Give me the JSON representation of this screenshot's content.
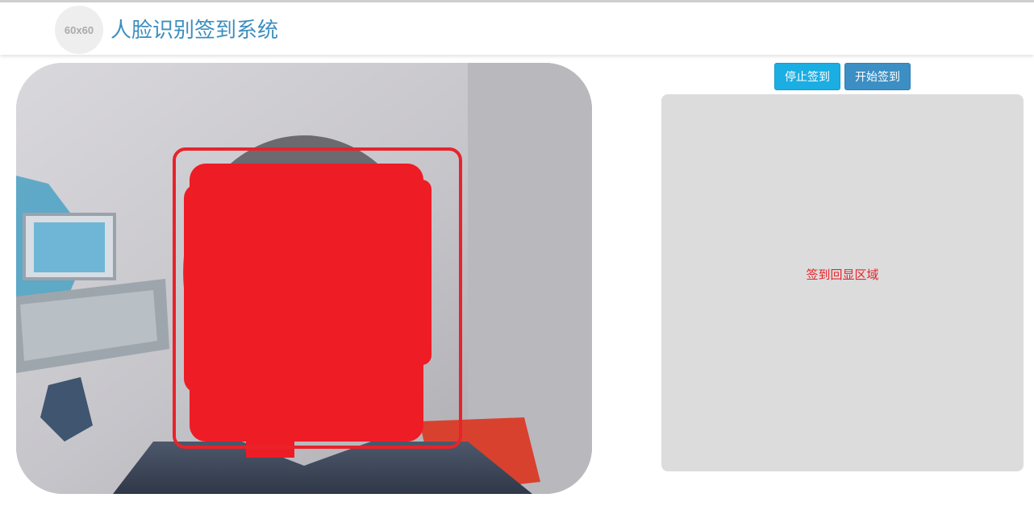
{
  "header": {
    "logo_text": "60x60",
    "title": "人脸识别签到系统"
  },
  "controls": {
    "stop_label": "停止签到",
    "start_label": "开始签到"
  },
  "result_panel": {
    "placeholder": "签到回显区域"
  },
  "colors": {
    "title": "#3d8ebf",
    "stop_button": "#1aaee3",
    "start_button": "#3c8fc4",
    "face_box": "#e8232b",
    "result_bg": "#dcdcdc"
  }
}
